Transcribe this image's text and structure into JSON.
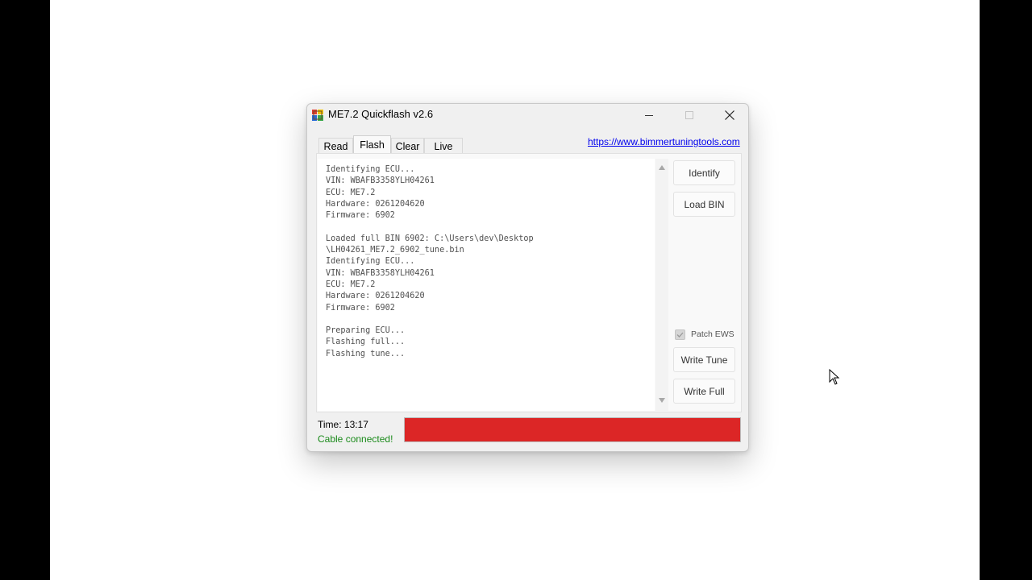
{
  "window": {
    "title": "ME7.2 Quickflash v2.6",
    "controls": {
      "minimize_icon": "minimize-icon",
      "maximize_icon": "maximize-icon",
      "close_icon": "close-icon"
    }
  },
  "tabs": [
    {
      "label": "Read",
      "active": false
    },
    {
      "label": "Flash",
      "active": true
    },
    {
      "label": "Clear",
      "active": false
    },
    {
      "label": "Live",
      "active": false
    }
  ],
  "link": {
    "text": "https://www.bimmertuningtools.com"
  },
  "log": {
    "lines": [
      "Identifying ECU...",
      "VIN: WBAFB3358YLH04261",
      "ECU: ME7.2",
      "Hardware: 0261204620",
      "Firmware: 6902",
      "",
      "Loaded full BIN 6902: C:\\Users\\dev\\Desktop",
      "\\LH04261_ME7.2_6902_tune.bin",
      "Identifying ECU...",
      "VIN: WBAFB3358YLH04261",
      "ECU: ME7.2",
      "Hardware: 0261204620",
      "Firmware: 6902",
      "",
      "Preparing ECU...",
      "Flashing full...",
      "Flashing tune..."
    ]
  },
  "buttons": {
    "identify": "Identify",
    "load_bin": "Load BIN",
    "write_tune": "Write Tune",
    "write_full": "Write Full"
  },
  "patch_ews": {
    "label": "Patch EWS",
    "checked": true,
    "enabled": false
  },
  "status": {
    "time": "Time: 13:17",
    "cable": "Cable connected!",
    "cable_color": "#1a8a1a"
  },
  "progress": {
    "value": 1.0,
    "color": "#dc2626"
  }
}
